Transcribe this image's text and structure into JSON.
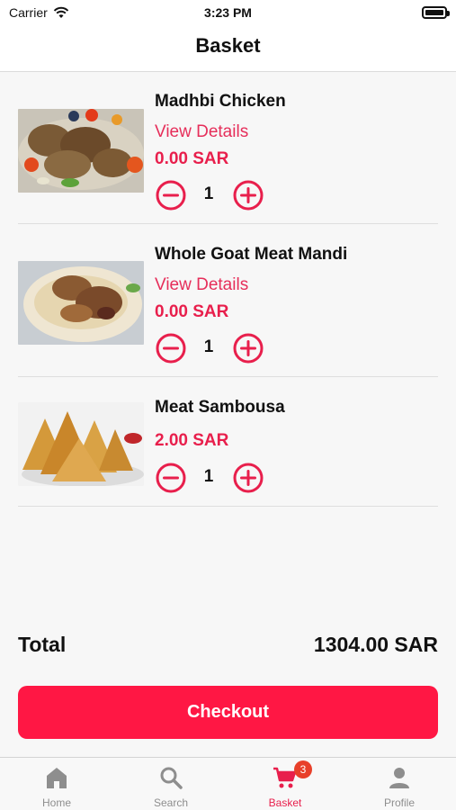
{
  "status_bar": {
    "carrier": "Carrier",
    "time": "3:23 PM"
  },
  "nav": {
    "title": "Basket"
  },
  "items": [
    {
      "name": "Madhbi Chicken",
      "link": "View Details",
      "price": "0.00 SAR",
      "quantity": "1",
      "image": "grilled-chicken-photo"
    },
    {
      "name": "Whole Goat Meat Mandi",
      "link": "View Details",
      "price": "0.00 SAR",
      "quantity": "1",
      "image": "goat-mandi-photo"
    },
    {
      "name": "Meat Sambousa",
      "price": "2.00 SAR",
      "quantity": "1",
      "image": "sambousa-photo"
    }
  ],
  "summary": {
    "total_label": "Total",
    "total_value": "1304.00 SAR"
  },
  "checkout": {
    "label": "Checkout"
  },
  "tabbar": {
    "tabs": [
      {
        "label": "Home",
        "icon": "home-icon"
      },
      {
        "label": "Search",
        "icon": "search-icon"
      },
      {
        "label": "Basket",
        "icon": "cart-icon",
        "badge": "3",
        "active": true
      },
      {
        "label": "Profile",
        "icon": "profile-icon"
      }
    ]
  },
  "colors": {
    "accent": "#e81f4c",
    "checkout_bg": "#ff1744",
    "badge": "#e8402a",
    "inactive_tab": "#8e8e8e"
  }
}
